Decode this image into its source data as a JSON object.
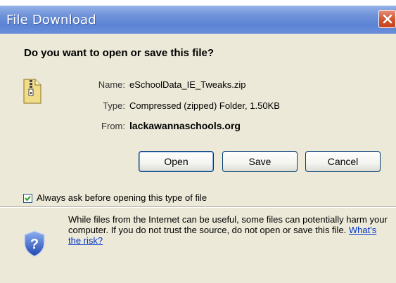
{
  "window": {
    "title": "File Download",
    "question": "Do you want to open or save this file?"
  },
  "file": {
    "name_label": "Name:",
    "name_value": "eSchoolData_IE_Tweaks.zip",
    "type_label": "Type:",
    "type_value": "Compressed (zipped) Folder, 1.50KB",
    "from_label": "From:",
    "from_value": "lackawannaschools.org"
  },
  "buttons": {
    "open": "Open",
    "save": "Save",
    "cancel": "Cancel"
  },
  "checkbox": {
    "label": "Always ask before opening this type of file",
    "checked": true
  },
  "warning": {
    "text": "While files from the Internet can be useful, some files can potentially harm your computer. If you do not trust the source, do not open or save this file.",
    "link": "What's the risk?"
  },
  "icons": {
    "close": "close-icon",
    "file": "zip-folder-icon",
    "security": "shield-question-icon",
    "check": "checkmark-icon"
  },
  "colors": {
    "titlebar": "#5b83d4",
    "close_button": "#d0542f",
    "dialog_background": "#ece9d8",
    "link": "#0033cc"
  }
}
